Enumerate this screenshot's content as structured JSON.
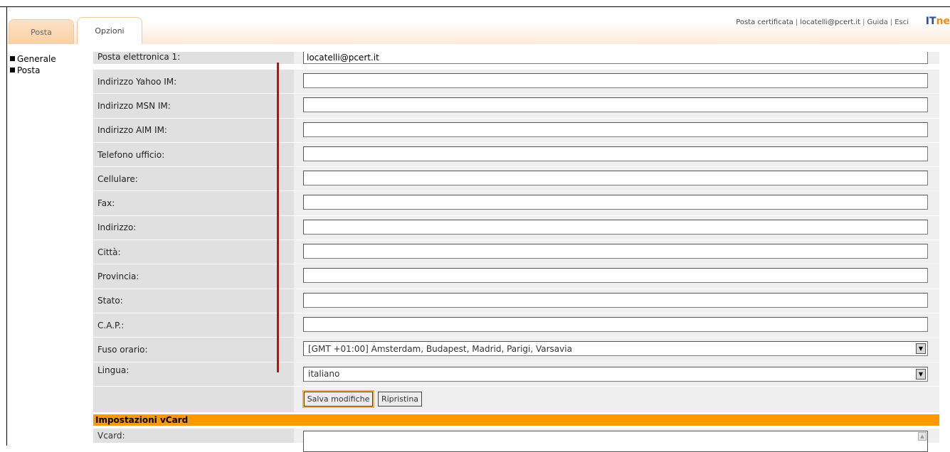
{
  "tabs": [
    "Posta",
    "Opzioni"
  ],
  "top_bar": {
    "account_type": "Posta certificata",
    "user": "locatelli@pcert.it",
    "help": "Guida",
    "logout": "Esci",
    "brand_a": "IT",
    "brand_b": "ne"
  },
  "sidebar": [
    "Generale",
    "Posta"
  ],
  "form": {
    "email_label": "Posta elettronica 1:",
    "email_value": "locatelli@pcert.it",
    "fields": [
      {
        "label": "Indirizzo Yahoo IM:",
        "value": ""
      },
      {
        "label": "Indirizzo MSN IM:",
        "value": ""
      },
      {
        "label": "Indirizzo AIM IM:",
        "value": ""
      },
      {
        "label": "Telefono ufficio:",
        "value": ""
      },
      {
        "label": "Cellulare:",
        "value": ""
      },
      {
        "label": "Fax:",
        "value": ""
      },
      {
        "label": "Indirizzo:",
        "value": ""
      },
      {
        "label": "Città:",
        "value": ""
      },
      {
        "label": "Provincia:",
        "value": ""
      },
      {
        "label": "Stato:",
        "value": ""
      },
      {
        "label": "C.A.P.:",
        "value": ""
      }
    ],
    "timezone_label": "Fuso orario:",
    "timezone_value": "[GMT +01:00] Amsterdam, Budapest, Madrid, Parigi, Varsavia",
    "language_label": "Lingua:",
    "language_value": "italiano",
    "save_button": "Salva modifiche",
    "reset_button": "Ripristina"
  },
  "vcard": {
    "section_title": "Impostazioni vCard",
    "label": "Vcard:"
  },
  "colors": {
    "section_bar": "#ff9900",
    "annotation_line": "#e00000"
  }
}
